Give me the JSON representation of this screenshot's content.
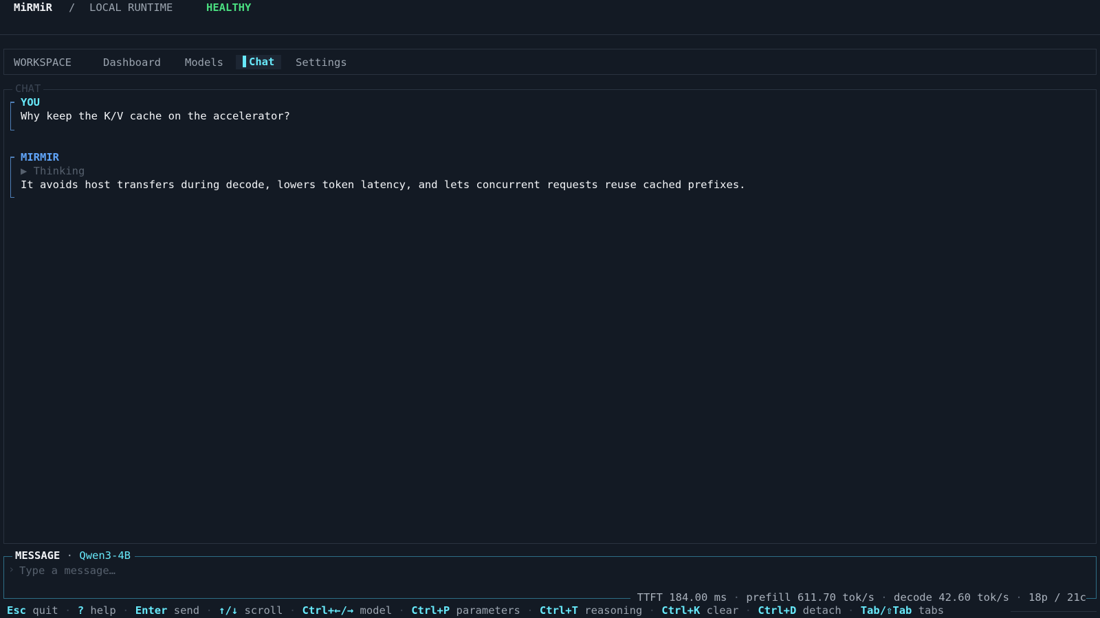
{
  "header": {
    "app_name": "MiRMiR",
    "separator": "/",
    "context": "LOCAL RUNTIME",
    "status": "HEALTHY"
  },
  "nav": {
    "section": "WORKSPACE",
    "tabs": [
      "Dashboard",
      "Models",
      "Chat",
      "Settings"
    ],
    "active_tab": "Chat"
  },
  "chat": {
    "title": "CHAT",
    "messages": [
      {
        "role": "YOU",
        "text": "Why keep the K/V cache on the accelerator?"
      },
      {
        "role": "MIRMIR",
        "thinking_label": "▶ Thinking",
        "text": "It avoids host transfers during decode, lowers token latency, and lets concurrent requests reuse cached prefixes."
      }
    ]
  },
  "composer": {
    "title": "MESSAGE",
    "dot": "·",
    "model": "Qwen3-4B",
    "placeholder": "Type a message…",
    "prompt_glyph": "›"
  },
  "stats": {
    "ttft": "TTFT 184.00 ms",
    "prefill": "prefill 611.70 tok/s",
    "decode": "decode 42.60 tok/s",
    "tokens": "18p / 21c",
    "sep": "·"
  },
  "shortcuts": [
    {
      "key": "Esc",
      "label": "quit"
    },
    {
      "key": "?",
      "label": "help"
    },
    {
      "key": "Enter",
      "label": "send"
    },
    {
      "key": "↑/↓",
      "label": "scroll"
    },
    {
      "key": "Ctrl+←/→",
      "label": "model"
    },
    {
      "key": "Ctrl+P",
      "label": "parameters"
    },
    {
      "key": "Ctrl+T",
      "label": "reasoning"
    },
    {
      "key": "Ctrl+K",
      "label": "clear"
    },
    {
      "key": "Ctrl+D",
      "label": "detach"
    },
    {
      "key": "Tab/⇧Tab",
      "label": "tabs"
    }
  ],
  "colors": {
    "background": "#131a24",
    "accent": "#67e8f9",
    "healthy": "#4ade80",
    "assistant": "#60a5fa"
  }
}
